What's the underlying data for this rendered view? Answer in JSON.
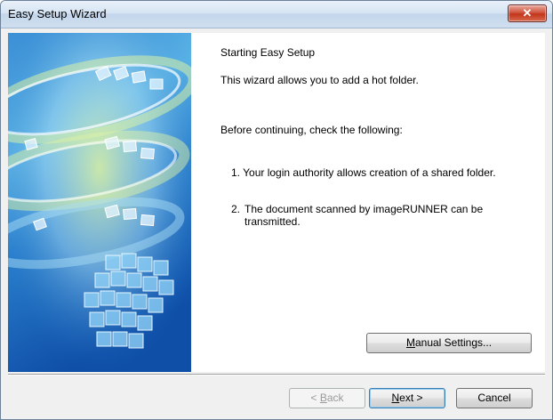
{
  "window": {
    "title": "Easy Setup Wizard",
    "close_glyph": "✕"
  },
  "content": {
    "heading": "Starting Easy Setup",
    "intro": "This wizard allows you to add a hot folder.",
    "check_intro": "Before continuing, check the following:",
    "items": [
      {
        "num": "1.",
        "text": "Your login authority allows creation of a shared folder."
      },
      {
        "num": "2.",
        "text": "The document scanned by imageRUNNER can be transmitted."
      }
    ]
  },
  "buttons": {
    "manual": {
      "mnemonic": "M",
      "rest": "anual Settings..."
    },
    "back": {
      "prefix": "< ",
      "mnemonic": "B",
      "rest": "ack"
    },
    "next": {
      "mnemonic": "N",
      "rest": "ext >"
    },
    "cancel": "Cancel"
  },
  "colors": {
    "art_primary": "#1f78c8",
    "art_light": "#a8dbf3",
    "art_accent": "#d9f0a6"
  }
}
